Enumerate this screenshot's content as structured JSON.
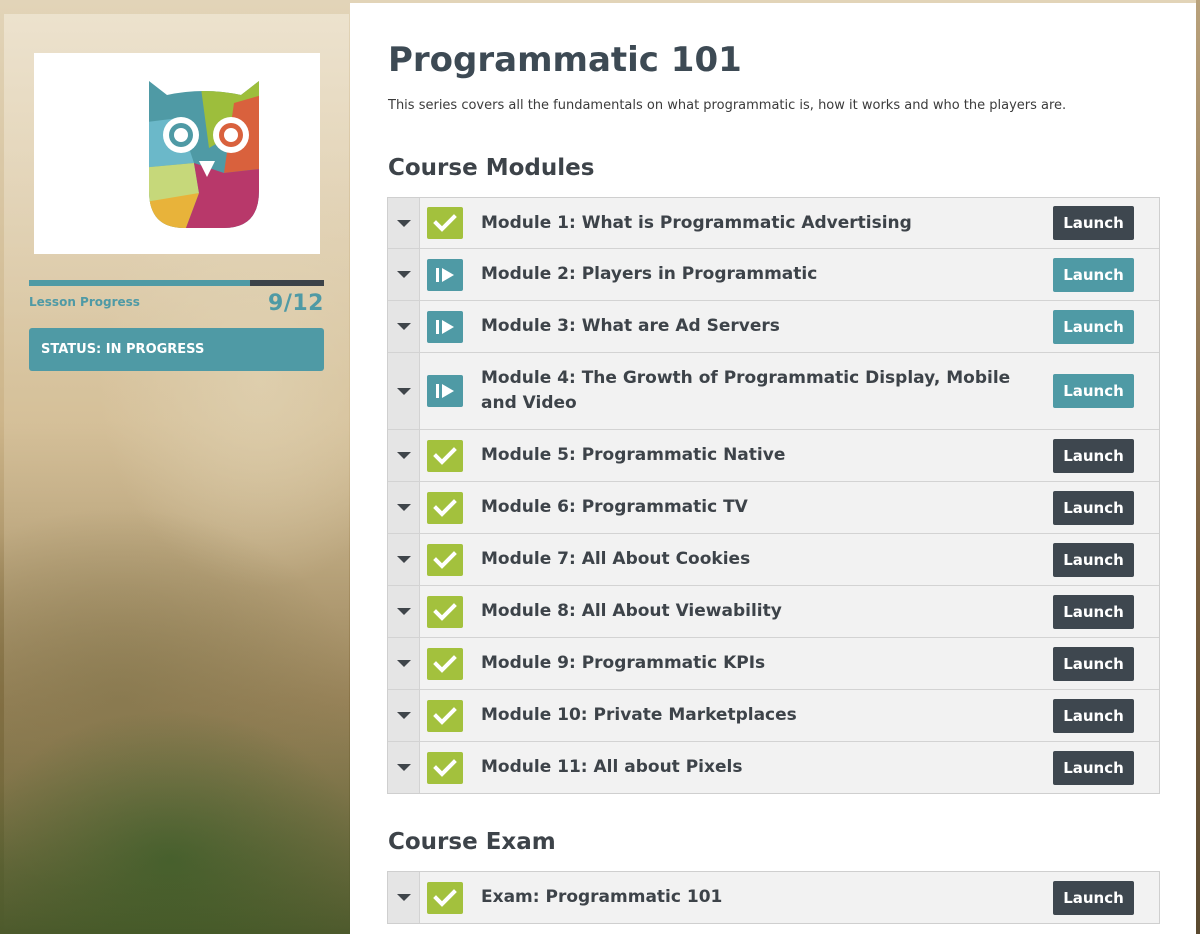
{
  "colors": {
    "accent_teal": "#4f9aa5",
    "complete_green": "#a3c13d",
    "launch_dark": "#3e474f",
    "heading": "#3d4a54"
  },
  "sidebar": {
    "logo_icon": "owl-logo",
    "progress": {
      "label": "Lesson Progress",
      "count": "9/12",
      "fraction": 0.75
    },
    "status": "STATUS: IN PROGRESS"
  },
  "main": {
    "title": "Programmatic 101",
    "description": "This series covers all the fundamentals on what programmatic is, how it works and who the players are.",
    "modules_heading": "Course Modules",
    "exam_heading": "Course Exam",
    "launch_label": "Launch",
    "modules": [
      {
        "title": "Module 1: What is Programmatic Advertising",
        "status": "complete",
        "status_icon": "check-icon"
      },
      {
        "title": "Module 2: Players in Programmatic",
        "status": "in_progress",
        "status_icon": "play-icon"
      },
      {
        "title": "Module 3: What are Ad Servers",
        "status": "in_progress",
        "status_icon": "play-icon"
      },
      {
        "title": "Module 4: The Growth of Programmatic Display, Mobile and Video",
        "status": "in_progress",
        "status_icon": "play-icon"
      },
      {
        "title": "Module 5: Programmatic Native",
        "status": "complete",
        "status_icon": "check-icon"
      },
      {
        "title": "Module 6: Programmatic TV",
        "status": "complete",
        "status_icon": "check-icon"
      },
      {
        "title": "Module 7: All About Cookies",
        "status": "complete",
        "status_icon": "check-icon"
      },
      {
        "title": "Module 8: All About Viewability",
        "status": "complete",
        "status_icon": "check-icon"
      },
      {
        "title": "Module 9: Programmatic KPIs",
        "status": "complete",
        "status_icon": "check-icon"
      },
      {
        "title": "Module 10: Private Marketplaces",
        "status": "complete",
        "status_icon": "check-icon"
      },
      {
        "title": "Module 11: All about Pixels",
        "status": "complete",
        "status_icon": "check-icon"
      }
    ],
    "exam": [
      {
        "title": "Exam: Programmatic 101",
        "status": "complete",
        "status_icon": "check-icon"
      }
    ]
  }
}
